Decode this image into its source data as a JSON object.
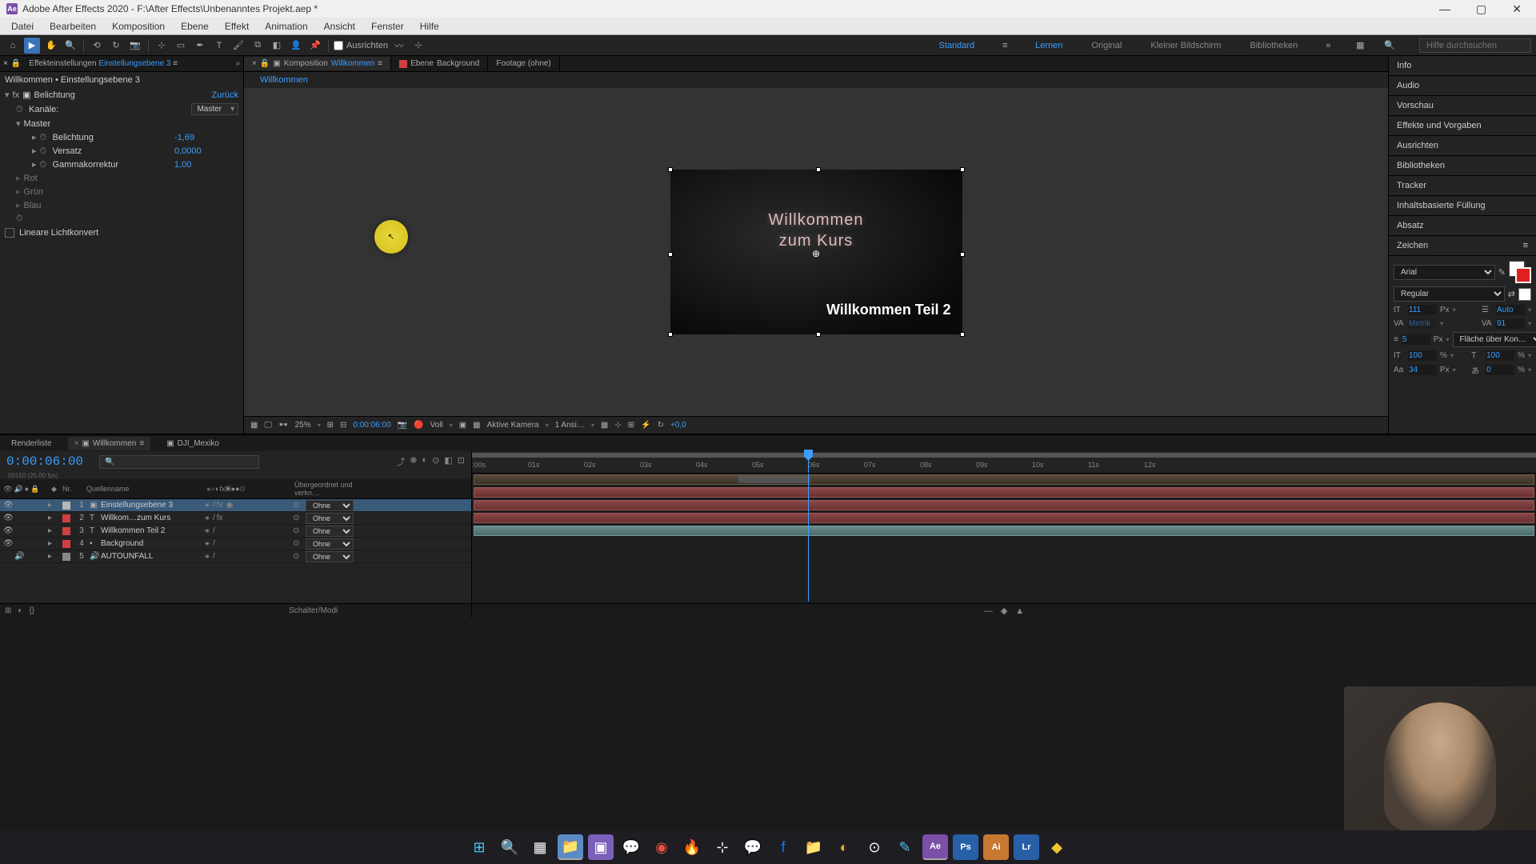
{
  "titlebar": {
    "app_icon": "Ae",
    "text": "Adobe After Effects 2020 - F:\\After Effects\\Unbenanntes Projekt.aep *"
  },
  "menu": [
    "Datei",
    "Bearbeiten",
    "Komposition",
    "Ebene",
    "Effekt",
    "Animation",
    "Ansicht",
    "Fenster",
    "Hilfe"
  ],
  "toolbar": {
    "ausrichten": "Ausrichten"
  },
  "workspaces": {
    "standard": "Standard",
    "lernen": "Lernen",
    "original": "Original",
    "kleiner": "Kleiner Bildschirm",
    "bibliotheken": "Bibliotheken",
    "search_placeholder": "Hilfe durchsuchen"
  },
  "effect_panel": {
    "tab_prefix": "Effekteinstellungen",
    "tab_name": "Einstellungsebene 3",
    "header": "Willkommen • Einstellungsebene 3",
    "effect_name": "Belichtung",
    "reset": "Zurück",
    "kanale_label": "Kanäle:",
    "kanale_value": "Master",
    "master": "Master",
    "belichtung_label": "Belichtung",
    "belichtung_value": "-1,69",
    "versatz_label": "Versatz",
    "versatz_value": "0,0000",
    "gamma_label": "Gammakorrektur",
    "gamma_value": "1,00",
    "rot": "Rot",
    "grun": "Grün",
    "blau": "Blau",
    "lineare": "Lineare Lichtkonvert"
  },
  "comp_tabs": {
    "komposition_prefix": "Komposition",
    "komposition_name": "Willkommen",
    "ebene_prefix": "Ebene",
    "ebene_name": "Background",
    "footage": "Footage (ohne)",
    "breadcrumb": "Willkommen"
  },
  "viewer": {
    "text1": "Willkommen",
    "text2": "zum Kurs",
    "text3": "Willkommen Teil 2",
    "zoom": "25%",
    "time": "0:00:06:00",
    "resolution": "Voll",
    "camera": "Aktive Kamera",
    "views": "1 Ansi…",
    "exposure": "+0,0"
  },
  "right_panels": {
    "info": "Info",
    "audio": "Audio",
    "vorschau": "Vorschau",
    "effekte": "Effekte und Vorgaben",
    "ausrichten": "Ausrichten",
    "bibliotheken": "Bibliotheken",
    "tracker": "Tracker",
    "inhalt": "Inhaltsbasierte Füllung",
    "absatz": "Absatz",
    "zeichen": "Zeichen"
  },
  "zeichen": {
    "font": "Arial",
    "style": "Regular",
    "size": "111",
    "size_unit": "Px",
    "leading": "Auto",
    "kerning": "Metrik",
    "tracking": "91",
    "stroke": "5",
    "stroke_unit": "Px",
    "fill_option": "Fläche über Kon…",
    "vscale": "100",
    "hscale": "100",
    "baseline": "34",
    "baseline_unit": "Px",
    "tsume": "0",
    "percent": "%"
  },
  "timeline": {
    "renderliste": "Renderliste",
    "tab1": "Willkommen",
    "tab2": "DJI_Mexiko",
    "time": "0:00:06:00",
    "time_sub": "00150 (25.00 fps)",
    "col_nr": "Nr.",
    "col_name": "Quellenname",
    "col_parent": "Übergeordnet und verkn…",
    "layers": [
      {
        "num": "1",
        "color": "#b8b8b8",
        "name": "Einstellungsebene 3",
        "parent": "Ohne",
        "type": "adj"
      },
      {
        "num": "2",
        "color": "#d04040",
        "name": "Willkom…zum Kurs",
        "parent": "Ohne",
        "type": "text"
      },
      {
        "num": "3",
        "color": "#d04040",
        "name": "Willkommen Teil 2",
        "parent": "Ohne",
        "type": "text"
      },
      {
        "num": "4",
        "color": "#d04040",
        "name": "Background",
        "parent": "Ohne",
        "type": "solid"
      },
      {
        "num": "5",
        "color": "#888",
        "name": "AUTOUNFALL",
        "parent": "Ohne",
        "type": "audio"
      }
    ],
    "schalter": "Schalter/Modi",
    "ticks": [
      ":00s",
      "01s",
      "02s",
      "03s",
      "04s",
      "05s",
      "06s",
      "07s",
      "08s",
      "09s",
      "10s",
      "11s",
      "12s"
    ]
  }
}
